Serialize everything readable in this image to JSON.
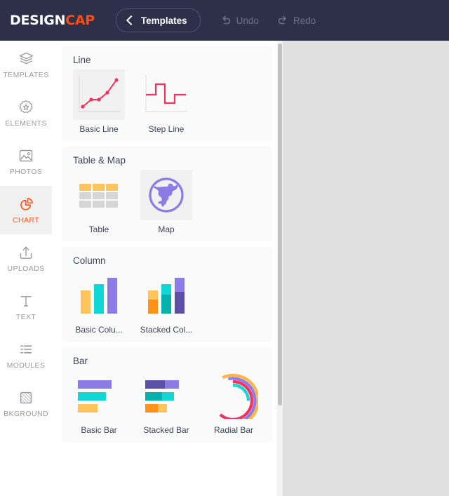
{
  "topbar": {
    "logo_design": "DESIGN",
    "logo_cap": "CAP",
    "templates_label": "Templates",
    "back_icon": "chevron-left-icon",
    "undo_label": "Undo",
    "redo_label": "Redo",
    "undo_icon": "undo-arrow-icon",
    "redo_icon": "redo-arrow-icon",
    "bg_color": "#2e3049",
    "accent_color": "#ff4b14",
    "disabled_color": "#6e7089"
  },
  "sidebar": {
    "active_color": "#ff5a26",
    "items": [
      {
        "label": "TEMPLATES",
        "icon": "layers-icon",
        "active": false
      },
      {
        "label": "ELEMENTS",
        "icon": "badge-star-icon",
        "active": false
      },
      {
        "label": "PHOTOS",
        "icon": "image-icon",
        "active": false
      },
      {
        "label": "CHART",
        "icon": "pie-chart-icon",
        "active": true
      },
      {
        "label": "UPLOADS",
        "icon": "upload-icon",
        "active": false
      },
      {
        "label": "TEXT",
        "icon": "text-t-icon",
        "active": false
      },
      {
        "label": "MODULES",
        "icon": "list-icon",
        "active": false
      },
      {
        "label": "BKGROUND",
        "icon": "background-icon",
        "active": false
      }
    ]
  },
  "panel": {
    "sections": [
      {
        "title": "Line",
        "items": [
          {
            "label": "Basic Line",
            "thumb": "basic-line-thumb",
            "hover": true
          },
          {
            "label": "Step Line",
            "thumb": "step-line-thumb",
            "hover": false
          }
        ]
      },
      {
        "title": "Table & Map",
        "items": [
          {
            "label": "Table",
            "thumb": "table-thumb",
            "hover": false
          },
          {
            "label": "Map",
            "thumb": "map-globe-thumb",
            "hover": true
          }
        ]
      },
      {
        "title": "Column",
        "items": [
          {
            "label": "Basic Colu...",
            "thumb": "basic-column-thumb",
            "hover": false
          },
          {
            "label": "Stacked Col...",
            "thumb": "stacked-column-thumb",
            "hover": false
          }
        ]
      },
      {
        "title": "Bar",
        "items": [
          {
            "label": "Basic Bar",
            "thumb": "basic-bar-thumb",
            "hover": false
          },
          {
            "label": "Stacked Bar",
            "thumb": "stacked-bar-thumb",
            "hover": false
          },
          {
            "label": "Radial Bar",
            "thumb": "radial-bar-thumb",
            "hover": false
          }
        ]
      }
    ]
  },
  "palette": {
    "line_red": "#f5325b",
    "orange_light": "#ffc45c",
    "orange_dark": "#ff9318",
    "cyan_light": "#11d6d6",
    "cyan_dark": "#03b2ac",
    "purple_light": "#8c7ae6",
    "purple_dark": "#5b4fa8",
    "gray_cell": "#d6d6d6",
    "canvas_bg": "#e0e0e0"
  }
}
